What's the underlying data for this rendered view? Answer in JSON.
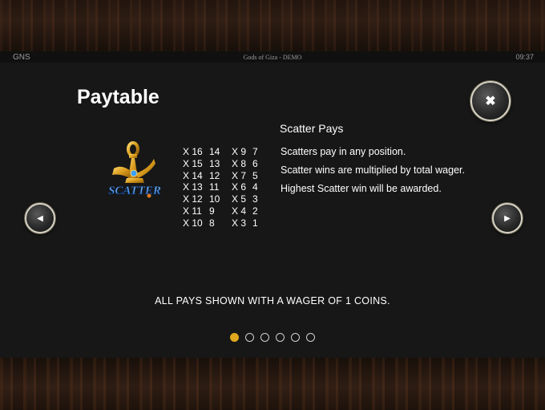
{
  "status": {
    "brand": "GNS",
    "game_title": "Gods of Giza - DEMO",
    "clock": "09:37"
  },
  "page": {
    "title": "Paytable"
  },
  "icons": {
    "close": "close-icon",
    "prev": "arrow-left-icon",
    "next": "arrow-right-icon",
    "scatter": "scatter-ankh-symbol"
  },
  "scatter": {
    "heading": "Scatter Pays",
    "symbol_label": "SCATTER",
    "pays": [
      {
        "count": "X 16",
        "win": "14",
        "count2": "X 9",
        "win2": "7"
      },
      {
        "count": "X 15",
        "win": "13",
        "count2": "X 8",
        "win2": "6"
      },
      {
        "count": "X 14",
        "win": "12",
        "count2": "X 7",
        "win2": "5"
      },
      {
        "count": "X 13",
        "win": "11",
        "count2": "X 6",
        "win2": "4"
      },
      {
        "count": "X 12",
        "win": "10",
        "count2": "X 5",
        "win2": "3"
      },
      {
        "count": "X 11",
        "win": "9",
        "count2": "X 4",
        "win2": "2"
      },
      {
        "count": "X 10",
        "win": "8",
        "count2": "X 3",
        "win2": "1"
      }
    ],
    "rules": [
      "Scatters pay in any position.",
      "Scatter wins are multiplied by total wager.",
      "Highest Scatter win will be awarded."
    ]
  },
  "footer_note": "ALL PAYS SHOWN WITH A WAGER OF 1 COINS.",
  "pagination": {
    "total": 6,
    "active_index": 0,
    "active_color": "#e0a81c"
  }
}
